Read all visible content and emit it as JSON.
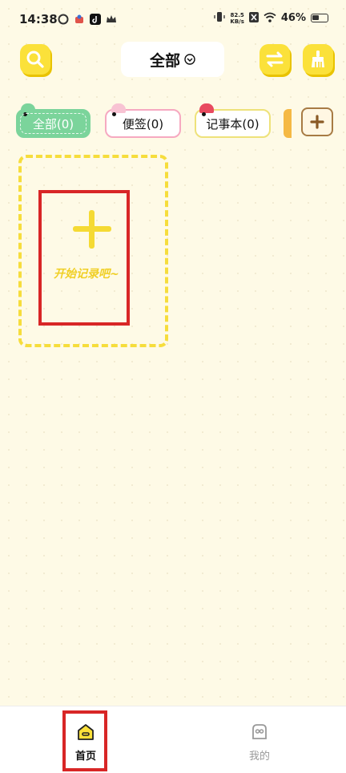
{
  "status_bar": {
    "time": "14:38",
    "net_speed_value": "82.5",
    "net_speed_unit": "KB/s",
    "battery_percent": "46%"
  },
  "header": {
    "title": "全部",
    "icons": [
      "search-icon",
      "swap-icon",
      "brush-icon"
    ]
  },
  "tags": [
    {
      "label": "全部(0)",
      "color": "#7bd49b",
      "selected": true
    },
    {
      "label": "便签(0)",
      "color": "#f6a9c1",
      "selected": false
    },
    {
      "label": "记事本(0)",
      "color": "#eee27a",
      "selected": false
    }
  ],
  "add_card": {
    "text": "开始记录吧~"
  },
  "bottom_nav": {
    "items": [
      {
        "label": "首页",
        "icon": "home-icon",
        "active": true
      },
      {
        "label": "我的",
        "icon": "profile-icon",
        "active": false
      }
    ]
  },
  "colors": {
    "accent": "#fbe13a",
    "background": "#fefae6",
    "highlight": "#d82626"
  }
}
